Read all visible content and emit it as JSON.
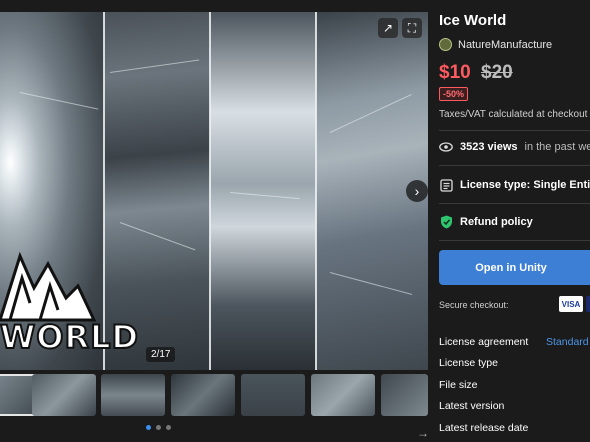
{
  "gallery": {
    "counter": "2/17",
    "logo_text": "WORLD",
    "thumb_count": 7,
    "dots": 3,
    "active_dot": 0
  },
  "product": {
    "title": "Ice World",
    "publisher": "NatureManufacture",
    "price": "$10",
    "original_price": "$20",
    "discount": "-50%",
    "tax_note": "Taxes/VAT calculated at checkout",
    "views_count": "3523 views",
    "views_suffix": "in the past week",
    "license_label": "License type: Single Entity",
    "refund_label": "Refund policy",
    "open_button": "Open in Unity",
    "secure_checkout": "Secure checkout:",
    "visa": "VISA"
  },
  "info_rows": [
    {
      "label": "License agreement",
      "value": "Standard Unity Asset Store EULA"
    },
    {
      "label": "License type",
      "value": ""
    },
    {
      "label": "File size",
      "value": ""
    },
    {
      "label": "Latest version",
      "value": ""
    },
    {
      "label": "Latest release date",
      "value": ""
    }
  ],
  "colors": {
    "sale_red": "#ff5a5f",
    "accent_blue": "#3d7fd4",
    "refund_green": "#2fc46e"
  },
  "icons": {
    "share": "share-icon",
    "expand": "expand-icon",
    "next": "chevron-right-icon",
    "views": "eye-icon",
    "license": "license-icon",
    "refund": "shield-check-icon"
  }
}
